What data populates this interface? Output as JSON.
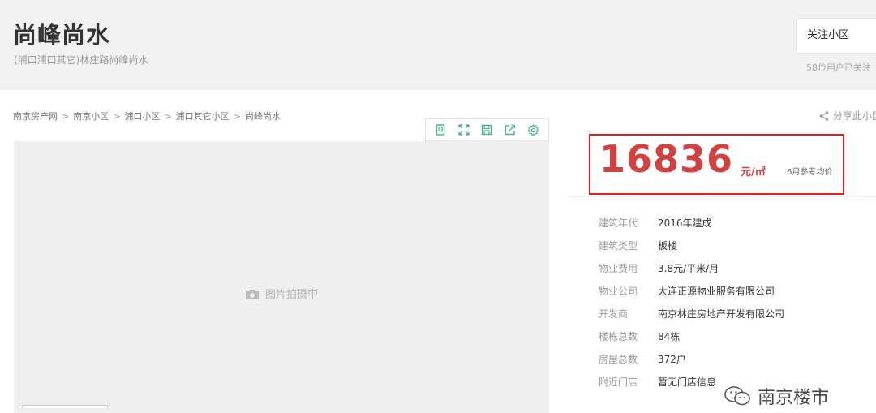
{
  "header": {
    "title": "尚峰尚水",
    "subtitle": "(浦口浦口其它)林庄路尚峰尚水",
    "follow_label": "关注小区",
    "follow_count": "58位用户已关注"
  },
  "breadcrumb": [
    "南京房产网",
    "南京小区",
    "浦口小区",
    "浦口其它小区",
    "尚峰尚水"
  ],
  "breadcrumb_sep": ">",
  "share_label": "分享此小区",
  "toolbar_icons": [
    "floorplan-icon",
    "fullscreen-icon",
    "save-icon",
    "share-out-icon",
    "settings-icon"
  ],
  "image_placeholder": "图片拍摄中",
  "price": {
    "value": "16836",
    "unit": "元/㎡",
    "note": "6月参考均价"
  },
  "info": [
    {
      "label": "建筑年代",
      "value": "2016年建成"
    },
    {
      "label": "建筑类型",
      "value": "板楼"
    },
    {
      "label": "物业费用",
      "value": "3.8元/平米/月"
    },
    {
      "label": "物业公司",
      "value": "大连正源物业服务有限公司"
    },
    {
      "label": "开发商",
      "value": "南京林庄房地产开发有限公司"
    },
    {
      "label": "楼栋总数",
      "value": "84栋"
    },
    {
      "label": "房屋总数",
      "value": "372户"
    },
    {
      "label": "附近门店",
      "value": "暂无门店信息"
    }
  ],
  "watermark": "南京楼市",
  "colors": {
    "accent_green": "#4db38a",
    "price_red": "#d34040",
    "highlight_border": "#e02020"
  }
}
